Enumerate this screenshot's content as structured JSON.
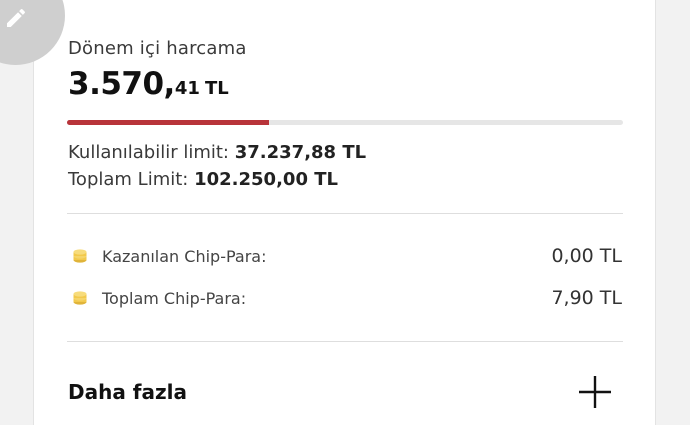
{
  "spending": {
    "label": "Dönem içi harcama",
    "amount_main": "3.570,",
    "amount_decimal": "41",
    "currency": "TL",
    "used_fraction": 0.363
  },
  "limits": {
    "available_label": "Kullanılabilir limit:",
    "available_value": "37.237,88 TL",
    "total_label": "Toplam Limit:",
    "total_value": "102.250,00 TL"
  },
  "chip_para": [
    {
      "label": "Kazanılan Chip-Para:",
      "value": "0,00 TL",
      "icon": "coin-stack-icon"
    },
    {
      "label": "Toplam Chip-Para:",
      "value": "7,90 TL",
      "icon": "coin-stack-icon"
    }
  ],
  "more": {
    "label": "Daha fazla",
    "icon": "plus-icon"
  },
  "colors": {
    "progress_fill": "#b8343a",
    "progress_track": "#e6e6e6",
    "coin": "#f2c94c",
    "edit_button_bg": "#cfcfcf"
  }
}
